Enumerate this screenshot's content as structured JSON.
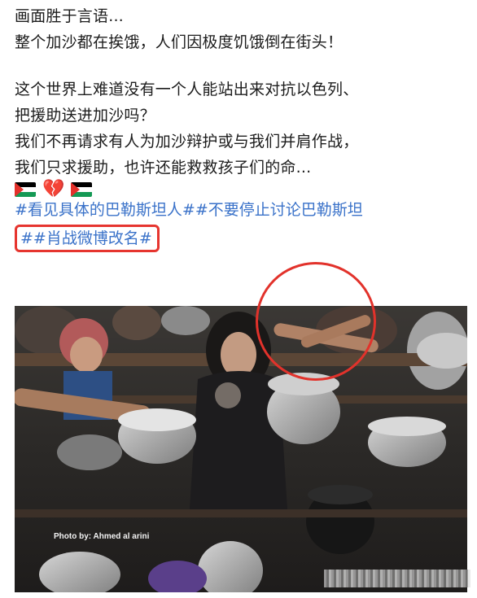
{
  "post": {
    "lines": [
      "画面胜于言语...",
      "整个加沙都在挨饿，人们因极度饥饿倒在街头！",
      "这个世界上难道没有一个人能站出来对抗以色列、",
      "把援助送进加沙吗？",
      "我们不再请求有人为加沙辩护或与我们并肩作战，",
      "我们只求援助，也许还能救救孩子们的命..."
    ],
    "emoji": [
      "palestine-flag",
      "broken-heart",
      "palestine-flag"
    ],
    "hashtags_line": "#看见具体的巴勒斯坦人##不要停止讨论巴勒斯坦",
    "hashtag_boxed": "##肖战微博改名#"
  },
  "photo": {
    "credit": "Photo by: Ahmed al arini"
  },
  "colors": {
    "hashtag": "#3a72c9",
    "highlight": "#e6352f"
  }
}
